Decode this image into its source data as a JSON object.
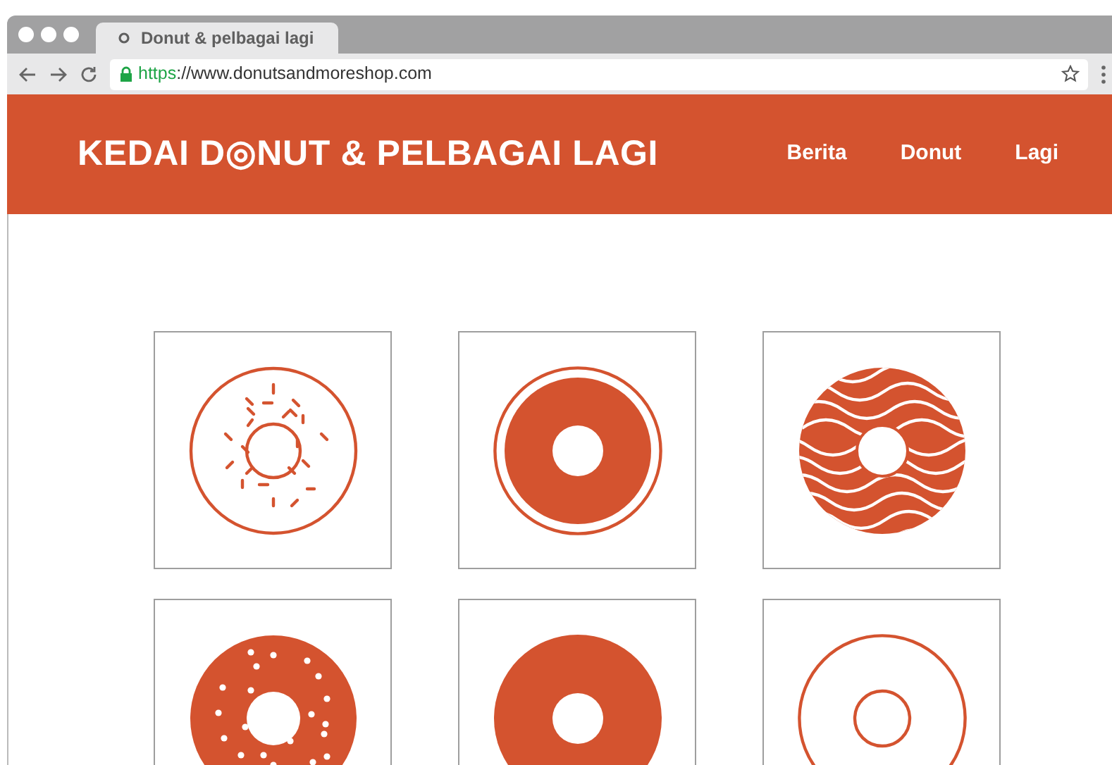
{
  "browser": {
    "tab_title": "Donut & pelbagai lagi",
    "url_scheme": "https",
    "url_rest": "://www.donutsandmoreshop.com"
  },
  "header": {
    "logo": "KEDAI D◎NUT & PELBAGAI LAGI",
    "nav": [
      "Berita",
      "Donut",
      "Lagi"
    ]
  },
  "donuts": [
    {
      "kind": "sprinkles"
    },
    {
      "kind": "ringed"
    },
    {
      "kind": "wavy"
    },
    {
      "kind": "dotted"
    },
    {
      "kind": "plain"
    },
    {
      "kind": "outline"
    }
  ]
}
